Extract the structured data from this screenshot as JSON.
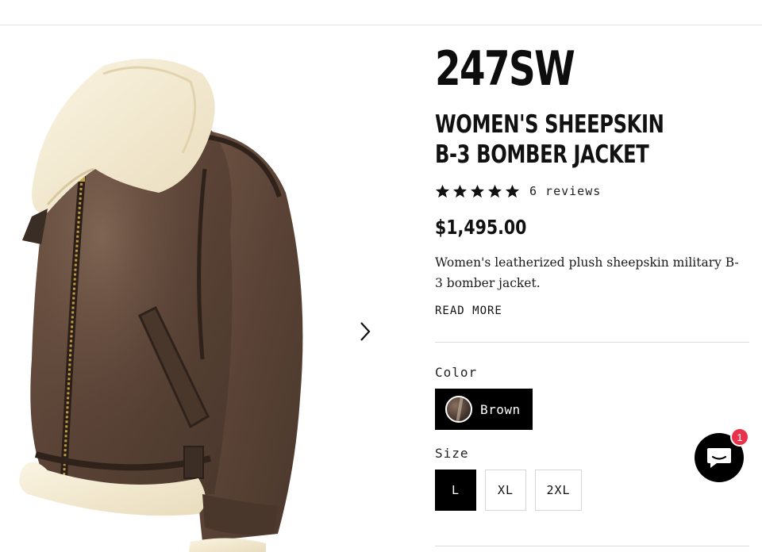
{
  "product": {
    "sku": "247SW",
    "title_line1": "WOMEN'S SHEEPSKIN",
    "title_line2": "B-3 BOMBER JACKET",
    "rating": 5,
    "reviews_label": "6 reviews",
    "price": "$1,495.00",
    "description": "Women's leatherized plush sheepskin military B-3 bomber jacket.",
    "read_more": "READ MORE"
  },
  "options": {
    "color_label": "Color",
    "color_selected": "Brown",
    "size_label": "Size",
    "sizes": [
      "L",
      "XL",
      "2XL"
    ],
    "size_selected": "L"
  },
  "chat": {
    "badge_count": "1"
  },
  "colors": {
    "accent": "#000000",
    "badge": "#e8334a",
    "jacket_leather": "#5b4437",
    "shearling": "#f3ead2"
  }
}
